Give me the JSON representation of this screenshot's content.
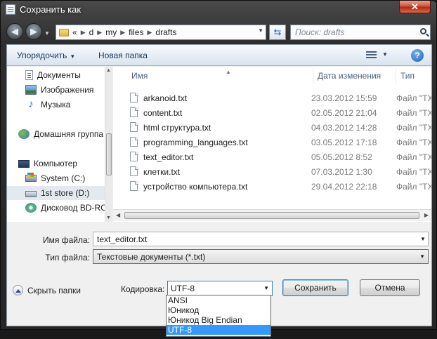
{
  "window": {
    "title": "Сохранить как",
    "close_label": "✕"
  },
  "address": {
    "crumbs": [
      "«",
      "d",
      "my",
      "files",
      "drafts"
    ],
    "search_placeholder": "Поиск: drafts"
  },
  "toolbar": {
    "organize": "Упорядочить",
    "new_folder": "Новая папка",
    "help": "?"
  },
  "sidebar": {
    "items": [
      {
        "label": "Документы",
        "icon": "documents-icon"
      },
      {
        "label": "Изображения",
        "icon": "pictures-icon"
      },
      {
        "label": "Музыка",
        "icon": "music-icon"
      },
      {
        "label": "Домашняя группа",
        "icon": "homegroup-icon"
      },
      {
        "label": "Компьютер",
        "icon": "computer-icon"
      },
      {
        "label": "System (C:)",
        "icon": "system-drive-icon"
      },
      {
        "label": "1st store (D:)",
        "icon": "drive-icon"
      },
      {
        "label": "Дисковод BD-RO",
        "icon": "bd-drive-icon"
      }
    ]
  },
  "columns": {
    "name": "Имя",
    "date": "Дата изменения",
    "type": "Тип"
  },
  "files": [
    {
      "name": "arkanoid.txt",
      "date": "23.03.2012 15:59",
      "type": "Файл \"TX"
    },
    {
      "name": "content.txt",
      "date": "02.05.2012 21:04",
      "type": "Файл \"TX"
    },
    {
      "name": "html структура.txt",
      "date": "04.03.2012 14:28",
      "type": "Файл \"TX"
    },
    {
      "name": "programming_languages.txt",
      "date": "03.05.2012 17:18",
      "type": "Файл \"TX"
    },
    {
      "name": "text_editor.txt",
      "date": "05.05.2012 8:52",
      "type": "Файл \"TX"
    },
    {
      "name": "клетки.txt",
      "date": "07.03.2012 1:30",
      "type": "Файл \"TX"
    },
    {
      "name": "устройство компьютера.txt",
      "date": "29.04.2012 22:18",
      "type": "Файл \"TX"
    }
  ],
  "form": {
    "filename_label": "Имя файла:",
    "filename_value": "text_editor.txt",
    "filetype_label": "Тип файла:",
    "filetype_value": "Текстовые документы (*.txt)"
  },
  "footer": {
    "hide_folders": "Скрыть папки",
    "encoding_label": "Кодировка:",
    "encoding_value": "UTF-8",
    "save": "Сохранить",
    "cancel": "Отмена"
  },
  "encoding_options": [
    "ANSI",
    "Юникод",
    "Юникод Big Endian",
    "UTF-8"
  ],
  "encoding_selected_index": 3
}
